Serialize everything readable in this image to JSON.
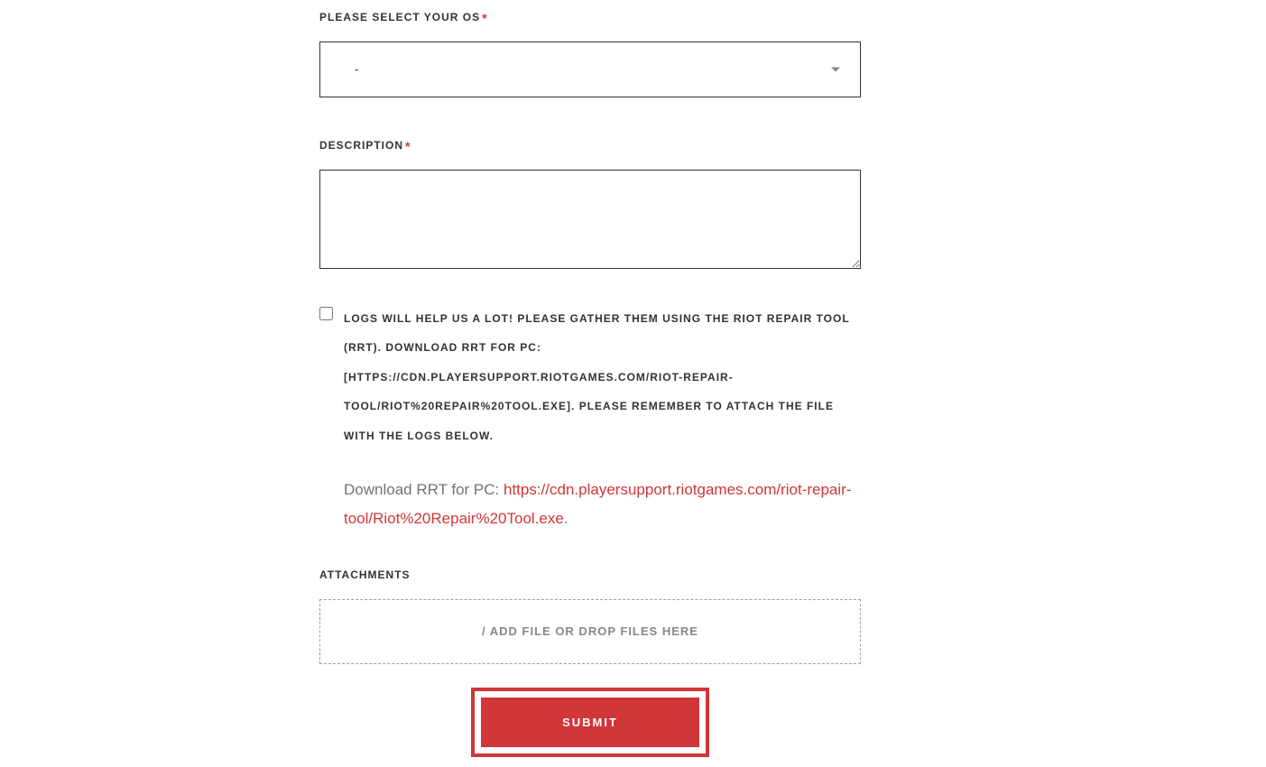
{
  "os_field": {
    "label": "PLEASE SELECT YOUR OS",
    "value": "-"
  },
  "description_field": {
    "label": "DESCRIPTION",
    "value": ""
  },
  "checkbox_field": {
    "label": "LOGS WILL HELP US A LOT! PLEASE GATHER THEM USING THE RIOT REPAIR TOOL (RRT). DOWNLOAD RRT FOR PC: [HTTPS://CDN.PLAYERSUPPORT.RIOTGAMES.COM/RIOT-REPAIR-TOOL/RIOT%20REPAIR%20TOOL.EXE]. PLEASE REMEMBER TO ATTACH THE FILE WITH THE LOGS BELOW."
  },
  "info": {
    "prefix": "Download RRT for PC: ",
    "link_text": "https://cdn.playersupport.riotgames.com/riot-repair-tool/Riot%20Repair%20Tool.exe",
    "suffix": "."
  },
  "attachments": {
    "label": "ATTACHMENTS",
    "dropzone_text": "/ ADD FILE OR DROP FILES HERE"
  },
  "submit": {
    "label": "SUBMIT"
  }
}
